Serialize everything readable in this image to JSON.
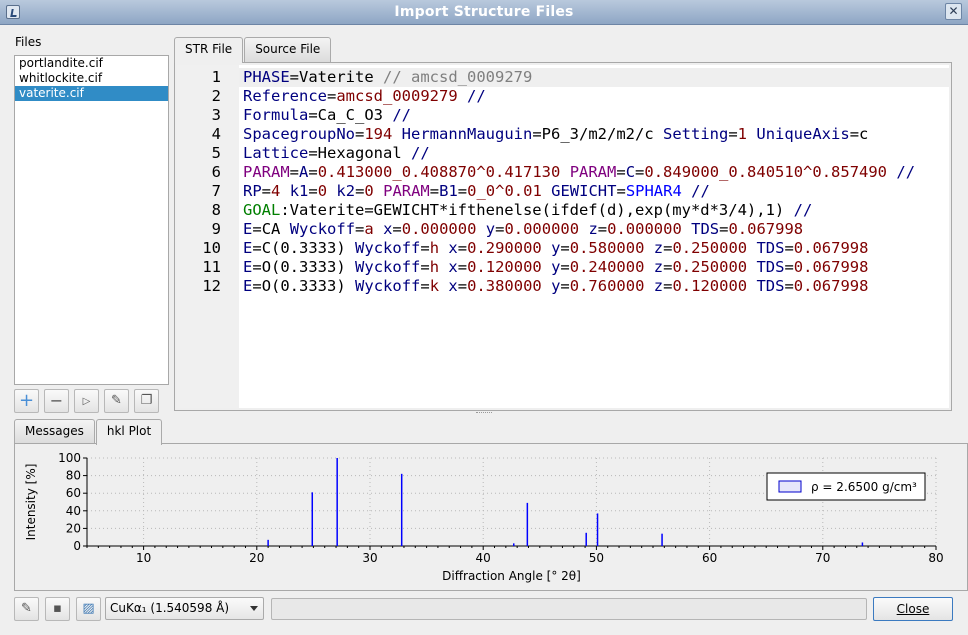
{
  "window": {
    "title": "Import Structure Files"
  },
  "files": {
    "label": "Files",
    "items": [
      {
        "name": "portlandite.cif",
        "selected": false
      },
      {
        "name": "whitlockite.cif",
        "selected": false
      },
      {
        "name": "vaterite.cif",
        "selected": true
      }
    ],
    "tools": [
      "add-icon",
      "remove-icon",
      "run-icon",
      "edit-icon",
      "copy-icon"
    ]
  },
  "editor_tabs": [
    {
      "label": "STR File",
      "active": true
    },
    {
      "label": "Source File",
      "active": false
    }
  ],
  "editor": {
    "line_numbers": [
      "1",
      "2",
      "3",
      "4",
      "5",
      "6",
      "7",
      "8",
      "9",
      "10",
      "11",
      "12"
    ],
    "lines": [
      "PHASE=Vaterite // amcsd_0009279",
      "Reference=amcsd_0009279 //",
      "Formula=Ca_C_O3 //",
      "SpacegroupNo=194 HermannMauguin=P6_3/m2/m2/c Setting=1 UniqueAxis=c",
      "Lattice=Hexagonal //",
      "PARAM=A=0.413000_0.408870^0.417130 PARAM=C=0.849000_0.840510^0.857490 //",
      "RP=4 k1=0 k2=0 PARAM=B1=0_0^0.01 GEWICHT=SPHAR4 //",
      "GOAL:Vaterite=GEWICHT*ifthenelse(ifdef(d),exp(my*d*3/4),1) //",
      "E=CA Wyckoff=a x=0.000000 y=0.000000 z=0.000000 TDS=0.067998",
      "E=C(0.3333) Wyckoff=h x=0.290000 y=0.580000 z=0.250000 TDS=0.067998",
      "E=O(0.3333) Wyckoff=h x=0.120000 y=0.240000 z=0.250000 TDS=0.067998",
      "E=O(0.3333) Wyckoff=k x=0.380000 y=0.760000 z=0.120000 TDS=0.067998"
    ]
  },
  "bottom_tabs": [
    {
      "label": "Messages",
      "active": false
    },
    {
      "label": "hkl Plot",
      "active": true
    }
  ],
  "chart_data": {
    "type": "bar",
    "xlabel": "Diffraction Angle [° 2θ]",
    "ylabel": "Intensity [%]",
    "xlim": [
      5,
      80
    ],
    "ylim": [
      0,
      100
    ],
    "xticks": [
      10,
      20,
      30,
      40,
      50,
      60,
      70,
      80
    ],
    "yticks": [
      0,
      20,
      40,
      60,
      80,
      100
    ],
    "legend": {
      "label": "ρ = 2.6500 g/cm³",
      "position": "top-right"
    },
    "bar_color": "#0000ff",
    "peaks": [
      {
        "x": 21.0,
        "y": 7
      },
      {
        "x": 24.9,
        "y": 61
      },
      {
        "x": 27.1,
        "y": 100
      },
      {
        "x": 32.8,
        "y": 82
      },
      {
        "x": 42.7,
        "y": 3
      },
      {
        "x": 43.9,
        "y": 49
      },
      {
        "x": 49.1,
        "y": 15
      },
      {
        "x": 50.1,
        "y": 37
      },
      {
        "x": 55.8,
        "y": 14
      },
      {
        "x": 73.5,
        "y": 4
      }
    ]
  },
  "footer": {
    "tools": [
      "edit-icon",
      "save-icon",
      "image-icon"
    ],
    "wavelength": "CuKα₁ (1.540598 Å)",
    "close_label": "Close"
  }
}
